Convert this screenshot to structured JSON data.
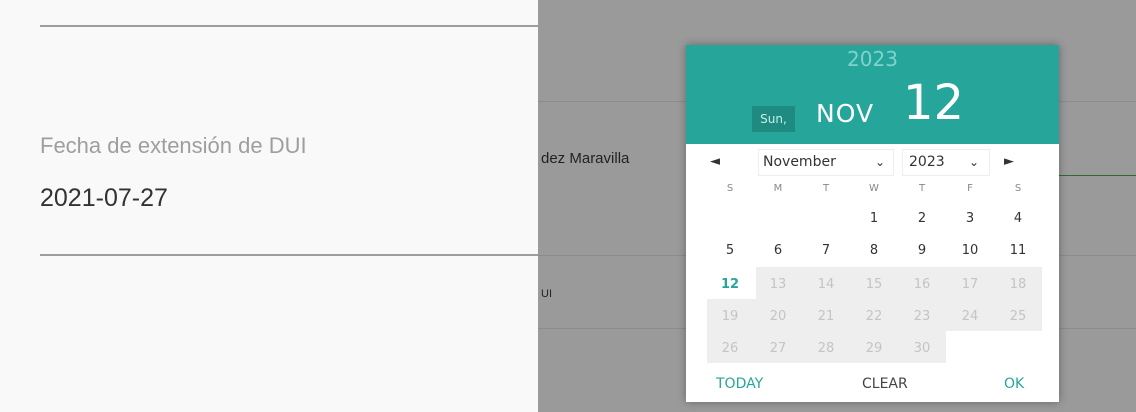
{
  "left_panel": {
    "field_label": "Fecha de extensión de DUI",
    "field_value": "2021-07-27"
  },
  "background": {
    "name_fragment": "dez Maravilla",
    "dui_fragment": "UI"
  },
  "datepicker": {
    "header": {
      "year": "2023",
      "weekday": "Sun,",
      "month": "NOV",
      "day": "12"
    },
    "nav": {
      "prev_icon": "◄",
      "next_icon": "►",
      "month_select": "November",
      "year_select": "2023"
    },
    "weekdays": [
      "S",
      "M",
      "T",
      "W",
      "T",
      "F",
      "S"
    ],
    "weeks": [
      [
        "",
        "",
        "",
        "1",
        "2",
        "3",
        "4"
      ],
      [
        "5",
        "6",
        "7",
        "8",
        "9",
        "10",
        "11"
      ],
      [
        "12",
        "13",
        "14",
        "15",
        "16",
        "17",
        "18"
      ],
      [
        "19",
        "20",
        "21",
        "22",
        "23",
        "24",
        "25"
      ],
      [
        "26",
        "27",
        "28",
        "29",
        "30",
        "",
        ""
      ]
    ],
    "selected_day": "12",
    "buttons": {
      "today": "TODAY",
      "clear": "CLEAR",
      "ok": "OK"
    }
  },
  "colors": {
    "accent": "#26a69a",
    "accent_dark": "#1f8a80",
    "overlay": "#9a9a9a"
  }
}
